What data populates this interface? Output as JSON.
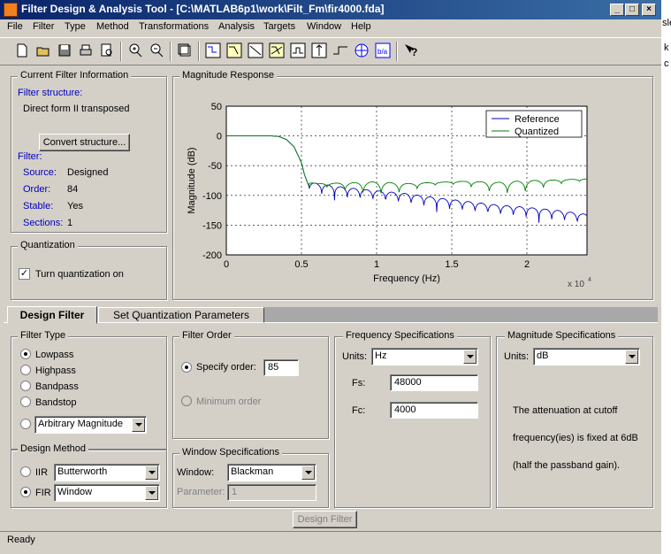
{
  "window": {
    "title": "Filter Design & Analysis Tool - [C:\\MATLAB6p1\\work\\Filt_Fm\\fir4000.fda]",
    "minimize": "_",
    "maximize": "□",
    "close": "×"
  },
  "menu": [
    "File",
    "Filter",
    "Type",
    "Method",
    "Transformations",
    "Analysis",
    "Targets",
    "Window",
    "Help"
  ],
  "background_right": {
    "text1": "sle",
    "text2": "k",
    "text3": "c"
  },
  "current_filter": {
    "title": "Current Filter Information",
    "structure_label": "Filter structure:",
    "structure_value": "Direct form II transposed",
    "convert_button": "Convert structure...",
    "filter_label": "Filter:",
    "source_label": "Source:",
    "source_value": "Designed",
    "order_label": "Order:",
    "order_value": "84",
    "stable_label": "Stable:",
    "stable_value": "Yes",
    "sections_label": "Sections:",
    "sections_value": "1"
  },
  "quantization": {
    "title": "Quantization",
    "checkbox_label": "Turn quantization on",
    "checked": true
  },
  "magnitude_response": {
    "title": "Magnitude Response"
  },
  "chart_data": {
    "type": "line",
    "title": "",
    "xlabel": "Frequency (Hz)",
    "ylabel": "Magnitude (dB)",
    "x_multiplier": "x 10",
    "x_multiplier_exp": "4",
    "xlim": [
      0,
      2.4
    ],
    "ylim": [
      -200,
      50
    ],
    "xticks": [
      "0",
      "0.5",
      "1",
      "1.5",
      "2"
    ],
    "yticks": [
      "50",
      "0",
      "-50",
      "-100",
      "-150",
      "-200"
    ],
    "grid": true,
    "legend_position": "top-right",
    "series": [
      {
        "name": "Reference",
        "color": "#0000c0",
        "x": [
          0,
          0.2,
          0.3,
          0.35,
          0.4,
          0.45,
          0.5,
          0.52,
          0.55,
          0.6,
          0.8,
          1.0,
          1.2,
          1.4,
          1.6,
          1.8,
          2.0,
          2.2,
          2.4
        ],
        "y": [
          0,
          0,
          0,
          -1,
          -6,
          -18,
          -45,
          -65,
          -85,
          -88,
          -95,
          -100,
          -105,
          -112,
          -118,
          -124,
          -128,
          -133,
          -140
        ]
      },
      {
        "name": "Quantized",
        "color": "#008000",
        "x": [
          0,
          0.2,
          0.3,
          0.35,
          0.4,
          0.45,
          0.5,
          0.52,
          0.55,
          0.6,
          0.8,
          1.0,
          1.2,
          1.4,
          1.6,
          1.8,
          2.0,
          2.2,
          2.4
        ],
        "y": [
          0,
          0,
          0,
          -1,
          -6,
          -18,
          -45,
          -65,
          -85,
          -88,
          -87,
          -85,
          -88,
          -86,
          -84,
          -86,
          -83,
          -82,
          -80
        ]
      }
    ]
  },
  "tabs": {
    "design": "Design Filter",
    "quant": "Set Quantization Parameters"
  },
  "filter_type": {
    "title": "Filter Type",
    "options": [
      "Lowpass",
      "Highpass",
      "Bandpass",
      "Bandstop"
    ],
    "arbitrary": "Arbitrary Magnitude"
  },
  "design_method": {
    "title": "Design Method",
    "iir_label": "IIR",
    "iir_value": "Butterworth",
    "fir_label": "FIR",
    "fir_value": "Window"
  },
  "filter_order": {
    "title": "Filter Order",
    "specify_label": "Specify order:",
    "specify_value": "85",
    "minimum_label": "Minimum order"
  },
  "window_specs": {
    "title": "Window Specifications",
    "window_label": "Window:",
    "window_value": "Blackman",
    "param_label": "Parameter:",
    "param_value": "1"
  },
  "freq_specs": {
    "title": "Frequency Specifications",
    "units_label": "Units:",
    "units_value": "Hz",
    "fs_label": "Fs:",
    "fs_value": "48000",
    "fc_label": "Fc:",
    "fc_value": "4000"
  },
  "mag_specs": {
    "title": "Magnitude Specifications",
    "units_label": "Units:",
    "units_value": "dB",
    "note_line1": "The attenuation at cutoff",
    "note_line2": "frequency(ies) is fixed at 6dB",
    "note_line3": "(half the passband gain)."
  },
  "design_button": "Design Filter",
  "status": "Ready"
}
